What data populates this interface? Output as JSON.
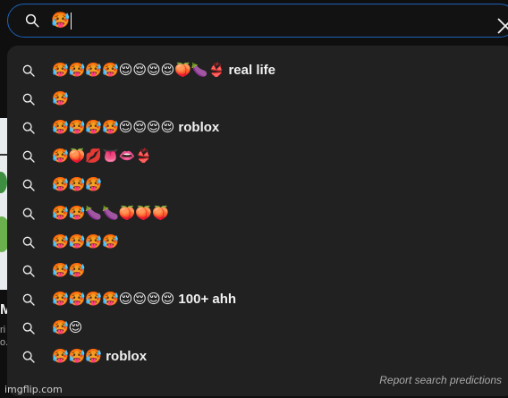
{
  "search": {
    "query": "🥵"
  },
  "suggestions": [
    {
      "emoji": "🥵🥵🥵🥵😌😌😌😌🍑🍆👙",
      "text": " real life"
    },
    {
      "emoji": "🥵",
      "text": ""
    },
    {
      "emoji": "🥵🥵🥵🥵😌😌😌😌",
      "text": " roblox"
    },
    {
      "emoji": "🥵🍑💋👅👄👙",
      "text": ""
    },
    {
      "emoji": "🥵🥵🥵",
      "text": ""
    },
    {
      "emoji": "🥵🥵🍆🍆🍑🍑🍑",
      "text": ""
    },
    {
      "emoji": "🥵🥵🥵🥵",
      "text": ""
    },
    {
      "emoji": "🥵🥵",
      "text": ""
    },
    {
      "emoji": "🥵🥵🥵🥵😌😌😌😌",
      "text": " 100+ ahh"
    },
    {
      "emoji": "🥵😌",
      "text": ""
    },
    {
      "emoji": "🥵🥵🥵",
      "text": " roblox"
    }
  ],
  "report_link": "Report search predictions",
  "background": {
    "title_fragment": "M",
    "meta_line1": "ri",
    "meta_line2": "o."
  },
  "watermark": "imgflip.com",
  "colors": {
    "page_bg": "#0f0f0f",
    "dropdown_bg": "#212121",
    "searchbar_border": "#1c62b9",
    "text_primary": "#f1f1f1",
    "text_secondary": "#aaaaaa"
  },
  "icons": {
    "search": "search-icon",
    "clear": "close-icon"
  }
}
